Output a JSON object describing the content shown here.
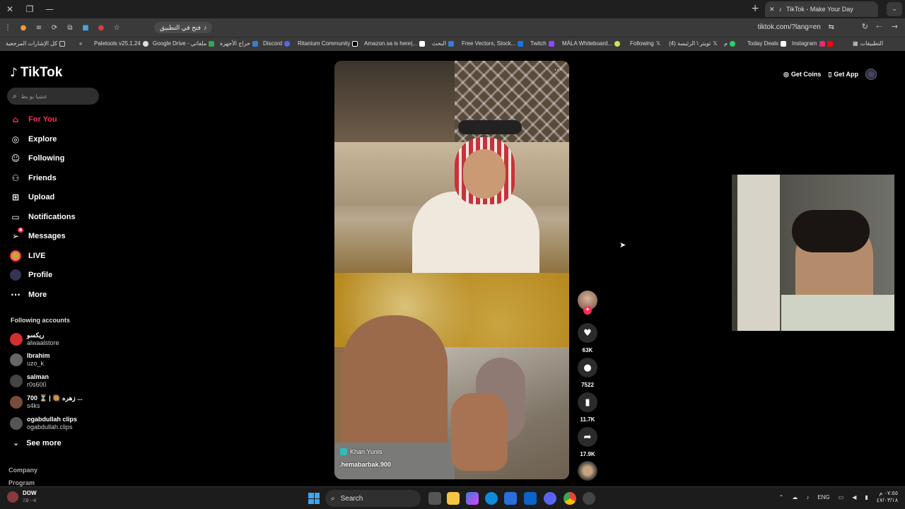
{
  "browser": {
    "tab_title": "TikTok - Make Your Day",
    "open_in_app": "فتح في التطبيق",
    "url": "tiktok.com/?lang=en",
    "bookmarks": [
      "كل الإشارات المرجعية",
      "Paletools v25.1.24",
      "Google Drive - ملفاتي",
      "حراج الأجهزة",
      "Discord",
      "Ritanium Community",
      "Amazon.sa is here|...",
      "البحث",
      "Free Vectors, Stock...",
      "Twitch",
      "MÁLA Whiteboard...",
      "Following",
      "(4) تويتر \\ الرئيسة",
      "م",
      "Today Deals",
      "Instagram",
      "التطبيقات"
    ]
  },
  "sidebar": {
    "logo": "TikTok",
    "search_placeholder": "عشيا يو بط",
    "nav": [
      {
        "label": "For You"
      },
      {
        "label": "Explore"
      },
      {
        "label": "Following"
      },
      {
        "label": "Friends"
      },
      {
        "label": "Upload"
      },
      {
        "label": "Notifications"
      },
      {
        "label": "Messages",
        "badge": "4"
      },
      {
        "label": "LIVE"
      },
      {
        "label": "Profile"
      },
      {
        "label": "More"
      }
    ],
    "following_title": "Following accounts",
    "accounts": [
      {
        "name": "ريكسو",
        "handle": "alwaalstore",
        "color": "#d32f2f"
      },
      {
        "name": "Ibrahim",
        "handle": "uzo_k",
        "color": "#666"
      },
      {
        "name": "salman",
        "handle": "r0s600",
        "color": "#444"
      },
      {
        "name": "700 ⏳ | 🥘 زهره ...",
        "handle": "s4ks",
        "color": "#7a4a3a"
      },
      {
        "name": "ogabdullah clips",
        "handle": "ogabdullah.clips",
        "color": "#555"
      }
    ],
    "see_more": "See more",
    "footer": [
      "Company",
      "Program"
    ]
  },
  "video": {
    "location": "Khan Yunis",
    "username": ".hemabarbak.900"
  },
  "actions": {
    "likes": "63K",
    "comments": "7522",
    "saves": "11.7K",
    "shares": "17.9K"
  },
  "topright": {
    "get_coins": "Get Coins",
    "get_app": "Get App"
  },
  "taskbar": {
    "weather_title": "DOW",
    "weather_sub": "٪٥٠-x",
    "search": "Search",
    "lang": "ENG",
    "time": "٠٧:٥٥ م",
    "date": "٤٧/٠٣/١٨"
  },
  "colors": {
    "accent": "#fe2c55",
    "bg": "#000000"
  }
}
